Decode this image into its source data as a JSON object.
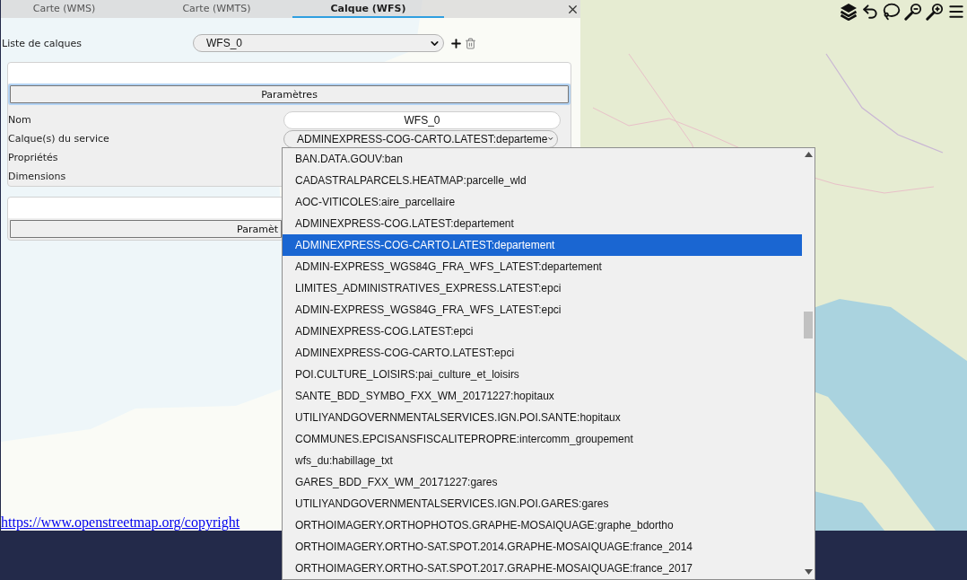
{
  "tabs": [
    {
      "label": "Carte (WMS)",
      "selected": false
    },
    {
      "label": "Carte (WMTS)",
      "selected": false
    },
    {
      "label": "Calque (WFS)",
      "selected": true
    }
  ],
  "layer_list": {
    "label": "Liste de calques",
    "value": "WFS_0"
  },
  "sections": [
    {
      "button": "Paramètres",
      "focused": true,
      "fields": [
        {
          "kind": "input",
          "label": "Nom",
          "value": "WFS_0"
        },
        {
          "kind": "select",
          "label": "Calque(s) du service",
          "value": "ADMINEXPRESS-COG-CARTO.LATEST:departeme"
        },
        {
          "kind": "text",
          "label": "Propriétés"
        },
        {
          "kind": "text",
          "label": "Dimensions"
        }
      ]
    },
    {
      "button": "Paramèt",
      "focused": false
    }
  ],
  "dropdown": {
    "options": [
      {
        "label": "BAN.DATA.GOUV:ban",
        "selected": false
      },
      {
        "label": "CADASTRALPARCELS.HEATMAP:parcelle_wld",
        "selected": false
      },
      {
        "label": "AOC-VITICOLES:aire_parcellaire",
        "selected": false
      },
      {
        "label": "ADMINEXPRESS-COG.LATEST:departement",
        "selected": false
      },
      {
        "label": "ADMINEXPRESS-COG-CARTO.LATEST:departement",
        "selected": true
      },
      {
        "label": "ADMIN-EXPRESS_WGS84G_FRA_WFS_LATEST:departement",
        "selected": false
      },
      {
        "label": "LIMITES_ADMINISTRATIVES_EXPRESS.LATEST:epci",
        "selected": false
      },
      {
        "label": "ADMIN-EXPRESS_WGS84G_FRA_WFS_LATEST:epci",
        "selected": false
      },
      {
        "label": "ADMINEXPRESS-COG.LATEST:epci",
        "selected": false
      },
      {
        "label": "ADMINEXPRESS-COG-CARTO.LATEST:epci",
        "selected": false
      },
      {
        "label": "POI.CULTURE_LOISIRS:pai_culture_et_loisirs",
        "selected": false
      },
      {
        "label": "SANTE_BDD_SYMBO_FXX_WM_20171227:hopitaux",
        "selected": false
      },
      {
        "label": "UTILIYANDGOVERNMENTALSERVICES.IGN.POI.SANTE:hopitaux",
        "selected": false
      },
      {
        "label": "COMMUNES.EPCISANSFISCALITEPROPRE:intercomm_groupement",
        "selected": false
      },
      {
        "label": "wfs_du:habillage_txt",
        "selected": false
      },
      {
        "label": "GARES_BDD_FXX_WM_20171227:gares",
        "selected": false
      },
      {
        "label": "UTILIYANDGOVERNMENTALSERVICES.IGN.POI.GARES:gares",
        "selected": false
      },
      {
        "label": "ORTHOIMAGERY.ORTHOPHOTOS.GRAPHE-MOSAIQUAGE:graphe_bdortho",
        "selected": false
      },
      {
        "label": "ORTHOIMAGERY.ORTHO-SAT.SPOT.2014.GRAPHE-MOSAIQUAGE:france_2014",
        "selected": false
      },
      {
        "label": "ORTHOIMAGERY.ORTHO-SAT.SPOT.2017.GRAPHE-MOSAIQUAGE:france_2017",
        "selected": false
      }
    ]
  },
  "attribution": "https://www.openstreetmap.org/copyright"
}
